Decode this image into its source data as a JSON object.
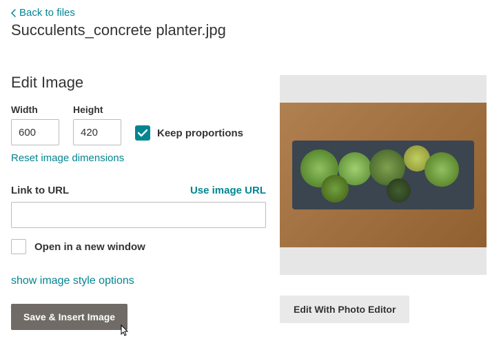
{
  "back_link": "Back to files",
  "filename": "Succulents_concrete planter.jpg",
  "edit_title": "Edit Image",
  "width_label": "Width",
  "height_label": "Height",
  "width_value": "600",
  "height_value": "420",
  "keep_proportions": "Keep proportions",
  "keep_proportions_checked": true,
  "reset_link": "Reset image dimensions",
  "url_label": "Link to URL",
  "use_image_url": "Use image URL",
  "url_value": "",
  "open_new_window": "Open in a new window",
  "open_new_window_checked": false,
  "style_options": "show image style options",
  "save_button": "Save & Insert Image",
  "edit_photo_button": "Edit With Photo Editor"
}
